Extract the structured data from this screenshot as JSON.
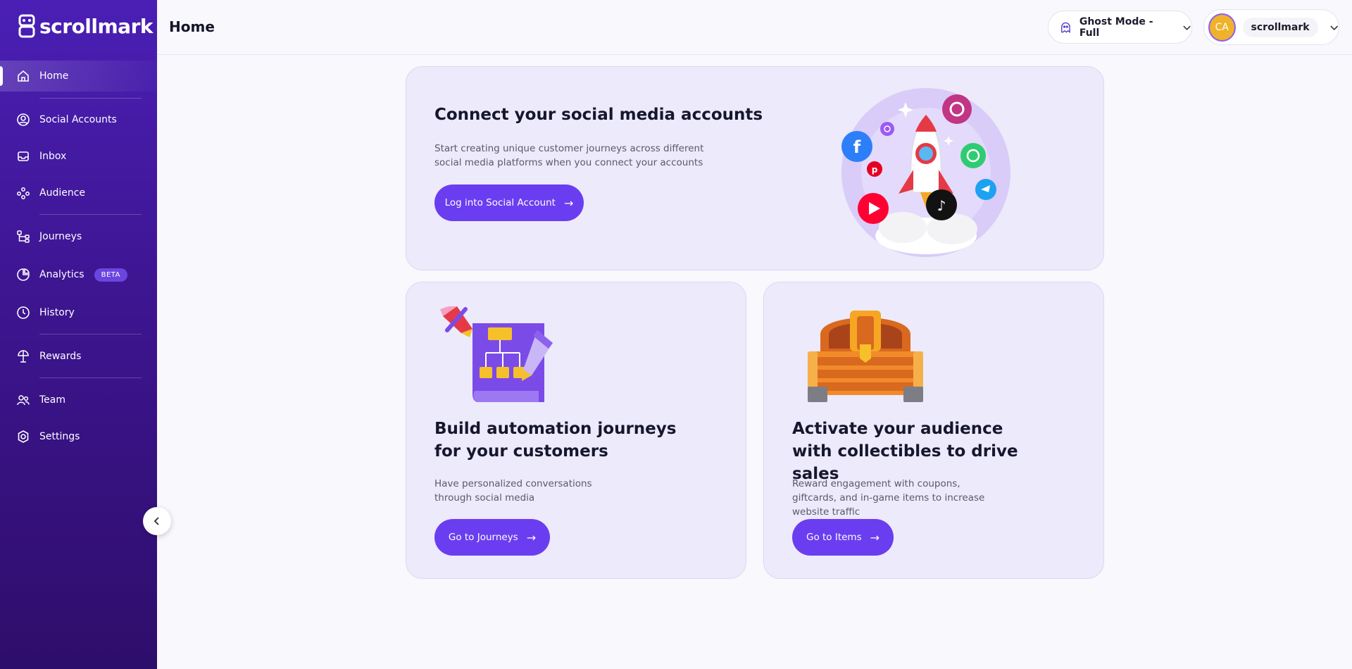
{
  "app": {
    "brand": "scrollmark",
    "page_title": "Home"
  },
  "sidebar": {
    "items": [
      {
        "label": "Home",
        "icon": "home-icon",
        "active": true
      },
      {
        "label": "Social Accounts",
        "icon": "user-circle-icon"
      },
      {
        "label": "Inbox",
        "icon": "inbox-icon"
      },
      {
        "label": "Audience",
        "icon": "audience-icon"
      },
      {
        "label": "Journeys",
        "icon": "journeys-icon"
      },
      {
        "label": "Analytics",
        "icon": "analytics-icon",
        "badge": "BETA"
      },
      {
        "label": "History",
        "icon": "clock-icon"
      },
      {
        "label": "Rewards",
        "icon": "gift-icon"
      },
      {
        "label": "Team",
        "icon": "team-icon"
      },
      {
        "label": "Settings",
        "icon": "gear-icon"
      }
    ]
  },
  "header": {
    "ghost_mode": "Ghost Mode - Full",
    "user": {
      "initials": "CA",
      "name": "scrollmark"
    }
  },
  "cards": {
    "connect": {
      "title": "Connect your social media accounts",
      "description": "Start creating unique customer journeys across different social media platforms when you connect your accounts",
      "button": "Log into Social Account"
    },
    "journeys": {
      "title": "Build automation journeys for your customers",
      "description": "Have personalized conversations through social media",
      "button": "Go to Journeys"
    },
    "audience": {
      "title": "Activate your audience with collectibles to drive sales",
      "description": "Reward engagement with coupons, giftcards, and in-game items to increase website traffic",
      "button": "Go to Items"
    }
  },
  "colors": {
    "sidebar_top": "#4a1fb5",
    "sidebar_bottom": "#2e0e6b",
    "accent": "#6b3df0",
    "card_bg": "#eceafb"
  }
}
